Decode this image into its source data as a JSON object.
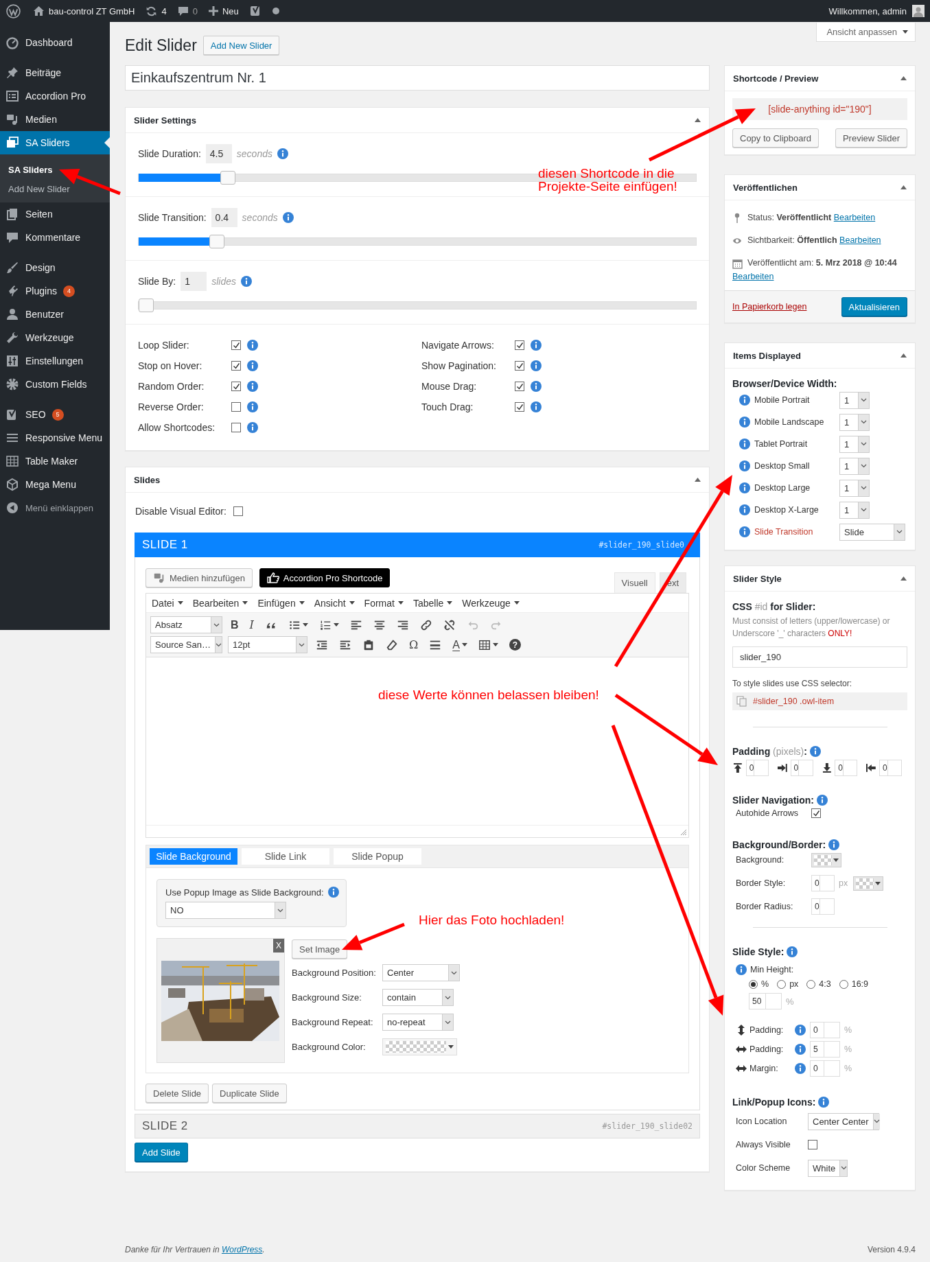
{
  "admin_bar": {
    "items": [
      {
        "kind": "logo"
      },
      {
        "kind": "home",
        "label": "bau-control ZT GmbH"
      },
      {
        "kind": "updates",
        "label": "4"
      },
      {
        "kind": "comments",
        "label": "0"
      },
      {
        "kind": "new",
        "label": "Neu"
      },
      {
        "kind": "seo"
      },
      {
        "kind": "dot"
      }
    ],
    "greeting": "Willkommen, admin"
  },
  "sidebar": {
    "groups": [
      {
        "items": [
          {
            "label": "Dashboard",
            "selected": false
          }
        ]
      },
      {
        "items": [
          {
            "label": "Beiträge",
            "selected": false
          },
          {
            "label": "Accordion Pro",
            "selected": false
          },
          {
            "label": "Medien",
            "selected": false
          },
          {
            "label": "SA Sliders",
            "selected": true,
            "children": [
              {
                "label": "SA Sliders",
                "selected": true
              },
              {
                "label": "Add New Slider",
                "selected": false
              }
            ]
          },
          {
            "label": "Seiten",
            "selected": false
          },
          {
            "label": "Kommentare",
            "selected": false
          }
        ]
      },
      {
        "items": [
          {
            "label": "Design",
            "selected": false
          },
          {
            "label": "Plugins",
            "selected": false,
            "badge": "4"
          },
          {
            "label": "Benutzer",
            "selected": false
          },
          {
            "label": "Werkzeuge",
            "selected": false
          },
          {
            "label": "Einstellungen",
            "selected": false
          },
          {
            "label": "Custom Fields",
            "selected": false
          }
        ]
      },
      {
        "items": [
          {
            "label": "SEO",
            "selected": false,
            "badge": "5"
          },
          {
            "label": "Responsive Menu",
            "selected": false
          },
          {
            "label": "Table Maker",
            "selected": false
          },
          {
            "label": "Mega Menu",
            "selected": false
          }
        ]
      }
    ],
    "collapse": "Menü einklappen"
  },
  "page": {
    "title": "Edit Slider",
    "add_button": "Add New Slider",
    "screen_options": "Ansicht anpassen"
  },
  "slider_name": "Einkaufszentrum Nr. 1",
  "slider_settings": {
    "title": "Slider Settings",
    "sliders": [
      {
        "label": "Slide Duration:",
        "value": "4.5",
        "unit": "seconds",
        "level": 0.15
      },
      {
        "label": "Slide Transition:",
        "value": "0.4",
        "unit": "seconds",
        "level": 0.13
      },
      {
        "label": "Slide By:",
        "value": "1",
        "unit": "slides",
        "level": 0
      }
    ],
    "checkboxes": [
      [
        {
          "label": "Loop Slider:",
          "checked": true
        },
        {
          "label": "Stop on Hover:",
          "checked": true
        },
        {
          "label": "Random Order:",
          "checked": true
        },
        {
          "label": "Reverse Order:",
          "checked": false
        },
        {
          "label": "Allow Shortcodes:",
          "checked": false
        }
      ],
      [
        {
          "label": "Navigate Arrows:",
          "checked": true
        },
        {
          "label": "Show Pagination:",
          "checked": true
        },
        {
          "label": "Mouse Drag:",
          "checked": true
        },
        {
          "label": "Touch Drag:",
          "checked": true
        }
      ]
    ]
  },
  "slides": {
    "title": "Slides",
    "disable_visual_editor": {
      "label": "Disable Visual Editor:",
      "checked": false
    },
    "items": [
      {
        "title": "SLIDE 1",
        "id": "#slider_190_slide0",
        "expanded": true,
        "media_button": "Medien hinzufügen",
        "shortcode_button": "Accordion Pro Shortcode",
        "mode_tabs": [
          {
            "label": "Visuell",
            "selected": true
          },
          {
            "label": "ext",
            "selected": false
          }
        ],
        "menu": [
          "Datei",
          "Bearbeiten",
          "Einfügen",
          "Ansicht",
          "Format",
          "Tabelle",
          "Werkzeuge"
        ],
        "toolbar": [
          [
            {
              "kind": "select",
              "value": "Absatz"
            },
            {
              "kind": "glyph",
              "text": "B",
              "dropdown": false,
              "disabled": false
            },
            {
              "kind": "glyph",
              "text": "I",
              "dropdown": false,
              "disabled": false
            },
            {
              "kind": "icon",
              "dropdown": false,
              "disabled": false
            },
            {
              "kind": "icon",
              "dropdown": true,
              "disabled": false
            },
            {
              "kind": "icon",
              "dropdown": true,
              "disabled": false
            },
            {
              "kind": "icon",
              "dropdown": false,
              "disabled": false
            },
            {
              "kind": "icon",
              "dropdown": false,
              "disabled": false
            },
            {
              "kind": "icon",
              "dropdown": false,
              "disabled": false
            },
            {
              "kind": "icon",
              "dropdown": false,
              "disabled": false
            },
            {
              "kind": "icon",
              "dropdown": false,
              "disabled": false
            },
            {
              "kind": "icon",
              "dropdown": false,
              "disabled": true
            },
            {
              "kind": "icon",
              "dropdown": false,
              "disabled": true
            }
          ],
          [
            {
              "kind": "select",
              "value": "Source San…"
            },
            {
              "kind": "select",
              "value": "12pt"
            },
            {
              "kind": "icon",
              "dropdown": false,
              "disabled": false
            },
            {
              "kind": "icon",
              "dropdown": false,
              "disabled": false
            },
            {
              "kind": "icon",
              "dropdown": false,
              "disabled": false
            },
            {
              "kind": "icon",
              "dropdown": false,
              "disabled": false
            },
            {
              "kind": "glyph",
              "text": "Ω",
              "dropdown": false,
              "disabled": false
            },
            {
              "kind": "icon",
              "dropdown": false,
              "disabled": false
            },
            {
              "kind": "glyph",
              "text": "A",
              "dropdown": true,
              "disabled": false
            },
            {
              "kind": "icon",
              "dropdown": true,
              "disabled": false
            },
            {
              "kind": "glyph",
              "text": "?",
              "dropdown": false,
              "disabled": false
            }
          ]
        ],
        "tabs": [
          {
            "label": "Slide Background",
            "selected": true
          },
          {
            "label": "Slide Link",
            "selected": false
          },
          {
            "label": "Slide Popup",
            "selected": false
          }
        ],
        "popup_background": {
          "label": "Use Popup Image as Slide Background:",
          "value": "NO"
        },
        "image": {
          "kind": "picture",
          "remove": "X"
        },
        "set_image": "Set Image",
        "fields": [
          {
            "label": "Background Position:",
            "kind": "select",
            "value": "Center"
          },
          {
            "label": "Background Size:",
            "kind": "select",
            "value": "contain"
          },
          {
            "label": "Background Repeat:",
            "kind": "select",
            "value": "no-repeat"
          },
          {
            "label": "Background Color:",
            "kind": "color"
          }
        ],
        "buttons": [
          "Delete Slide",
          "Duplicate Slide"
        ]
      },
      {
        "title": "SLIDE 2",
        "id": "#slider_190_slide02",
        "expanded": false
      }
    ],
    "add_button": "Add Slide"
  },
  "shortcode": {
    "title": "Shortcode / Preview",
    "code": "[slide-anything id=\"190\"]",
    "buttons": [
      "Copy to Clipboard",
      "Preview Slider"
    ]
  },
  "publish": {
    "title": "Veröffentlichen",
    "rows": [
      {
        "label": "Status:",
        "value": "Veröffentlicht",
        "link": "Bearbeiten"
      },
      {
        "label": "Sichtbarkeit:",
        "value": "Öffentlich",
        "link": "Bearbeiten"
      },
      {
        "label": "Veröffentlicht am:",
        "value": "5. Mrz 2018 @ 10:44",
        "link": "Bearbeiten"
      }
    ],
    "trash": "In Papierkorb legen",
    "update": "Aktualisieren"
  },
  "items_displayed": {
    "title": "Items Displayed",
    "heading": "Browser/Device Width:",
    "rows": [
      {
        "label": "Mobile Portrait",
        "value": "1",
        "kind": "count"
      },
      {
        "label": "Mobile Landscape",
        "value": "1",
        "kind": "count"
      },
      {
        "label": "Tablet Portrait",
        "value": "1",
        "kind": "count"
      },
      {
        "label": "Desktop Small",
        "value": "1",
        "kind": "count"
      },
      {
        "label": "Desktop Large",
        "value": "1",
        "kind": "count"
      },
      {
        "label": "Desktop X-Large",
        "value": "1",
        "kind": "count"
      },
      {
        "label": "Slide Transition",
        "value": "Slide",
        "kind": "transition"
      }
    ]
  },
  "slider_style": {
    "title": "Slider Style",
    "css_heading": "**CSS** #id **for Slider:**",
    "hint": "Must consist of letters (upper/lowercase) or Underscore '_' characters",
    "hint_emphasis": "ONLY!",
    "css_value": "slider_190",
    "selector_label": "To style slides use CSS selector:",
    "selector": "#slider_190 .owl-item",
    "padding": {
      "heading": "**Padding** (pixels)**:**",
      "values": [
        "0",
        "0",
        "0",
        "0"
      ]
    },
    "navigation": {
      "heading": "Slider Navigation:",
      "label": "Autohide Arrows",
      "checked": true
    },
    "background": {
      "heading": "Background/Border:",
      "background_label": "Background:",
      "border_label": "Border Style:",
      "border_value": "0",
      "border_unit": "px",
      "radius_label": "Border Radius:",
      "radius_value": "0"
    },
    "slide_style": {
      "heading": "Slide Style:",
      "min_height_label": "Min Height:",
      "units": [
        {
          "label": "%",
          "selected": true
        },
        {
          "label": "px",
          "selected": false
        },
        {
          "label": "4:3",
          "selected": false
        },
        {
          "label": "16:9",
          "selected": false
        }
      ],
      "min_height_value": "50",
      "min_height_unit": "%",
      "spacing": [
        {
          "label": "Padding:",
          "value": "0",
          "unit": "%"
        },
        {
          "label": "Padding:",
          "value": "5",
          "unit": "%"
        },
        {
          "label": "Margin:",
          "value": "0",
          "unit": "%"
        }
      ]
    },
    "link_icons": {
      "heading": "Link/Popup Icons:",
      "location_label": "Icon Location",
      "location": "Center Center",
      "visible_label": "Always Visible",
      "visible": false,
      "scheme_label": "Color Scheme",
      "scheme": "White"
    }
  },
  "footer": {
    "text": "Danke für Ihr Vertrauen in",
    "link": "WordPress",
    "end": ".",
    "version": "Version 4.9.4"
  },
  "annotations": [
    {
      "lines": [
        "diesen Shortcode in die",
        "Projekte-Seite einfügen!"
      ]
    },
    {
      "lines": [
        "diese Werte können belassen bleiben!"
      ]
    },
    {
      "lines": [
        "Hier das Foto hochladen!"
      ]
    }
  ]
}
